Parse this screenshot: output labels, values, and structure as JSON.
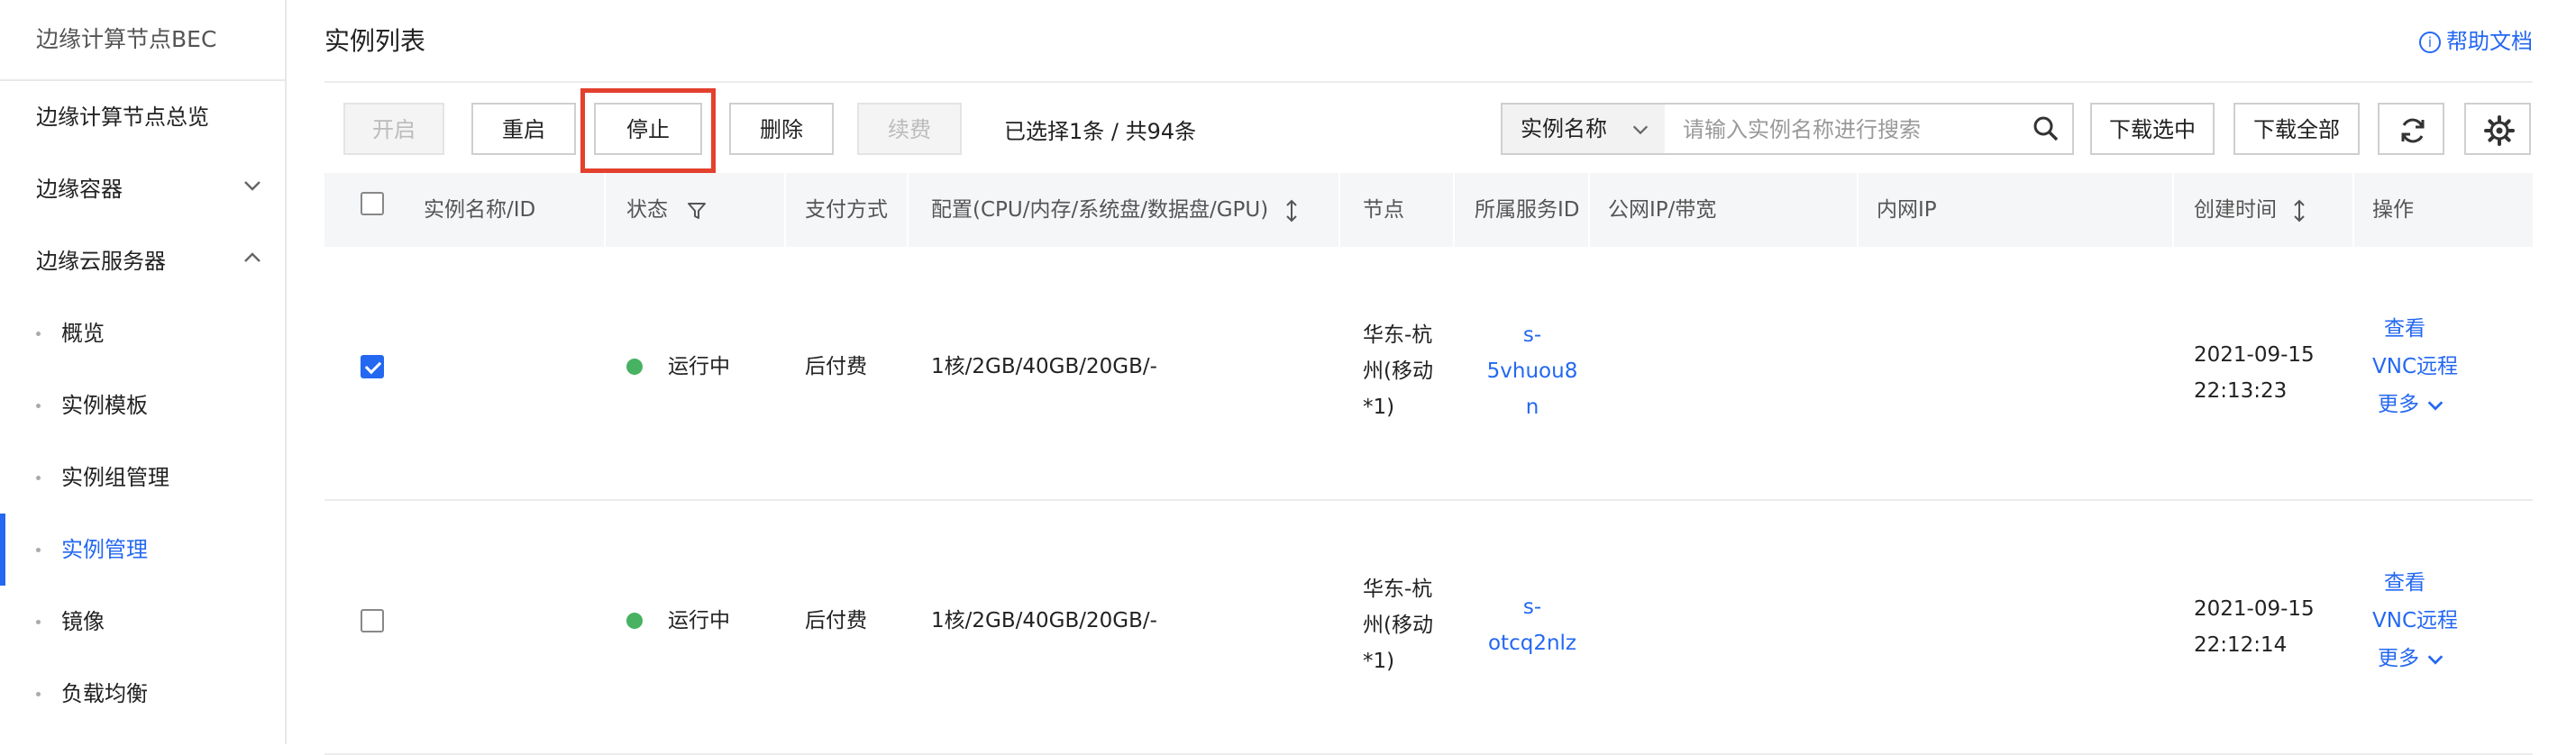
{
  "sidebar": {
    "title": "边缘计算节点BEC",
    "items": [
      {
        "label": "边缘计算节点总览"
      },
      {
        "label": "边缘容器"
      },
      {
        "label": "边缘云服务器"
      }
    ],
    "subitems": [
      {
        "label": "概览"
      },
      {
        "label": "实例模板"
      },
      {
        "label": "实例组管理"
      },
      {
        "label": "实例管理"
      },
      {
        "label": "镜像"
      },
      {
        "label": "负载均衡"
      }
    ]
  },
  "header": {
    "title": "实例列表",
    "help": "帮助文档"
  },
  "toolbar": {
    "start": "开启",
    "restart": "重启",
    "stop": "停止",
    "delete": "删除",
    "renew": "续费",
    "selection": "已选择1条 / 共94条",
    "download_selected": "下载选中",
    "download_all": "下载全部"
  },
  "search": {
    "field": "实例名称",
    "placeholder": "请输入实例名称进行搜索"
  },
  "table": {
    "headers": {
      "name": "实例名称/ID",
      "status": "状态",
      "payment": "支付方式",
      "config": "配置(CPU/内存/系统盘/数据盘/GPU)",
      "node": "节点",
      "service": "所属服务ID",
      "public_ip": "公网IP/带宽",
      "private_ip": "内网IP",
      "created": "创建时间",
      "ops": "操作"
    },
    "rows": [
      {
        "checked": true,
        "status": "运行中",
        "payment": "后付费",
        "config": "1核/2GB/40GB/20GB/-",
        "node": [
          "华东-杭",
          "州(移动",
          "*1)"
        ],
        "service": [
          "s-",
          "5vhuou8",
          "n"
        ],
        "created": [
          "2021-09-15",
          "22:13:23"
        ],
        "op_view": "查看",
        "op_vnc": "VNC远程",
        "op_more": "更多"
      },
      {
        "checked": false,
        "status": "运行中",
        "payment": "后付费",
        "config": "1核/2GB/40GB/20GB/-",
        "node": [
          "华东-杭",
          "州(移动",
          "*1)"
        ],
        "service": [
          "s-",
          "otcq2nlz"
        ],
        "created": [
          "2021-09-15",
          "22:12:14"
        ],
        "op_view": "查看",
        "op_vnc": "VNC远程",
        "op_more": "更多"
      }
    ]
  },
  "colors": {
    "accent": "#2468f2",
    "highlight": "#e3402e",
    "running": "#47b262"
  },
  "icons": [
    "chevron-down-icon",
    "chevron-up-icon",
    "info-icon",
    "filter-icon",
    "sort-icon",
    "search-icon",
    "refresh-icon",
    "gear-icon"
  ]
}
